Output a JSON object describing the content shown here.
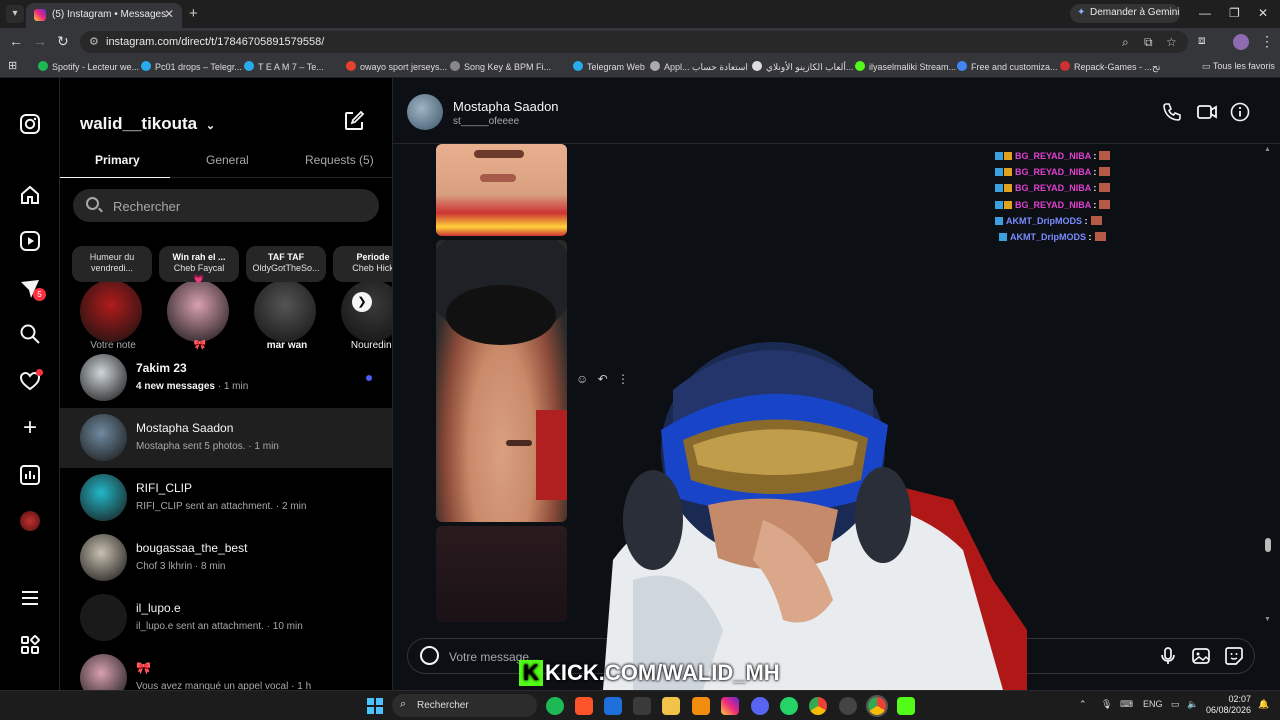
{
  "browser": {
    "tab_title": "(5) Instagram • Messages",
    "gemini_button": "Demander à Gemini",
    "url": "instagram.com/direct/t/17846705891579558/",
    "bookmarks": [
      {
        "label": "Spotify - Lecteur we...",
        "color": "#1db954"
      },
      {
        "label": "Pc01 drops – Telegr...",
        "color": "#2aabee"
      },
      {
        "label": "T E A M 7 – Te...",
        "color": "#2aabee"
      },
      {
        "label": "owayo sport jerseys...",
        "color": "#e5412d"
      },
      {
        "label": "Song Key & BPM Fi...",
        "color": "#888888"
      },
      {
        "label": "Telegram Web",
        "color": "#2aabee"
      },
      {
        "label": "Appl... استعادة حساب",
        "color": "#aaaaaa"
      },
      {
        "label": "ألعاب الكازينو الأونلاي...",
        "color": "#dddddd"
      },
      {
        "label": "ilyaselmaliki Stream...",
        "color": "#53fc18"
      },
      {
        "label": "Free and customiza...",
        "color": "#4285f4"
      },
      {
        "label": "Repack-Games - ...تح",
        "color": "#d03030"
      }
    ],
    "all_bookmarks": "Tous les favoris"
  },
  "rail": {
    "notification_count": "5"
  },
  "inbox": {
    "username": "walid__tikouta",
    "tabs": [
      "Primary",
      "General",
      "Requests (5)"
    ],
    "search_placeholder": "Rechercher",
    "notes": [
      {
        "bubble_line1": "Humeur du",
        "bubble_line2": "vendredi...",
        "name": "Votre note",
        "avatar_color": "#b01c1c"
      },
      {
        "bubble_line1": "Win rah el ...",
        "bubble_line2": "Cheb Faycal",
        "bubble_line3": "💗",
        "name": "🎀",
        "avatar_color": "#d8a0b0"
      },
      {
        "bubble_line1": "TAF TAF",
        "bubble_line2": "OldyGotTheSo...",
        "name": "mar wan",
        "avatar_color": "#555555"
      },
      {
        "bubble_line1": "Periode",
        "bubble_line2": "Cheb Hick",
        "name": "Nouredine",
        "avatar_color": "#3a3a3a"
      }
    ],
    "conversations": [
      {
        "name": "7akim 23",
        "sub_bold": "4 new messages",
        "sub_time": " · 1 min",
        "unread": true,
        "avatar_color": "#cfd6da"
      },
      {
        "name": "Mostapha Saadon",
        "sub": "Mostapha sent 5 photos.",
        "sub_time": " · 1 min",
        "selected": true,
        "avatar_color": "#6f8aa0"
      },
      {
        "name": "RIFI_CLIP",
        "sub": "RIFI_CLIP sent an attachment.",
        "sub_time": " · 2 min",
        "avatar_color": "#22b8c8"
      },
      {
        "name": "bougassaa_the_best",
        "sub": "Chof 3 lkhrin",
        "sub_time": " · 8 min",
        "avatar_color": "#c9c0b0"
      },
      {
        "name": "il_lupo.e",
        "sub": "il_lupo.e sent an attachment.",
        "sub_time": " · 10 min",
        "avatar_color": "#1a1a1a"
      },
      {
        "name": "🎀",
        "sub": "Vous avez manqué un appel vocal",
        "sub_time": " · 1 h",
        "avatar_color": "#d8a0b0"
      }
    ]
  },
  "chat": {
    "name": "Mostapha Saadon",
    "handle": "st_____ofeeee",
    "composer_placeholder": "Votre message...",
    "stream_chat": [
      {
        "user": "BG_REYAD_NIBA",
        "color": "#e040d0"
      },
      {
        "user": "BG_REYAD_NIBA",
        "color": "#e040d0"
      },
      {
        "user": "BG_REYAD_NIBA",
        "color": "#e040d0"
      },
      {
        "user": "BG_REYAD_NIBA",
        "color": "#e040d0"
      },
      {
        "user": "AKMT_DripMODS",
        "color": "#7a8cff"
      },
      {
        "user": "AKMT_DripMODS",
        "color": "#7a8cff"
      }
    ],
    "overlay_text": "KICK.COM/WALID_MH"
  },
  "taskbar": {
    "search_placeholder": "Rechercher",
    "language": "ENG",
    "time": "02:07",
    "date": "06/08/2026"
  }
}
